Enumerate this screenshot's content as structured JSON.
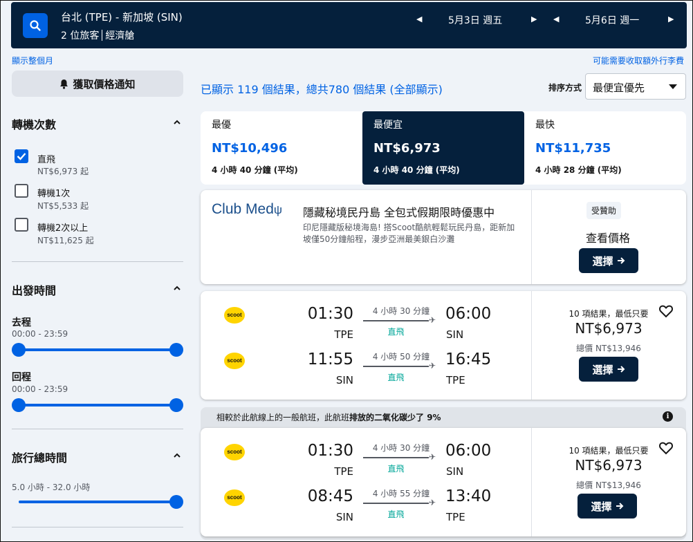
{
  "search": {
    "route": "台北 (TPE) - 新加坡 (SIN)",
    "travellers": "2 位旅客",
    "cabin": "經濟艙",
    "depart_date": "5月3日 週五",
    "return_date": "5月6日 週一"
  },
  "links": {
    "show_month": "顯示整個月",
    "bag_fees": "可能需要收取額外行李費"
  },
  "sidebar": {
    "price_alert": "獲取價格通知",
    "stops_title": "轉機次數",
    "stops": [
      {
        "label": "直飛",
        "price": "NT$6,973 起",
        "checked": true
      },
      {
        "label": "轉機1次",
        "price": "NT$5,533 起",
        "checked": false
      },
      {
        "label": "轉機2次以上",
        "price": "NT$11,625 起",
        "checked": false
      }
    ],
    "departure_title": "出發時間",
    "outbound_label": "去程",
    "outbound_range": "00:00 - 23:59",
    "return_label": "回程",
    "return_range": "00:00 - 23:59",
    "duration_title": "旅行總時間",
    "duration_range": "5.0 小時 - 32.0 小時"
  },
  "results": {
    "count_text": "已顯示 119 個結果，總共780 個結果 (全部顯示)",
    "sort_label": "排序方式",
    "sort_value": "最便宜優先"
  },
  "tabs": [
    {
      "label": "最優",
      "price": "NT$10,496",
      "duration": "4 小時 40 分鐘 (平均)",
      "active": false
    },
    {
      "label": "最便宜",
      "price": "NT$6,973",
      "duration": "4 小時 40 分鐘 (平均)",
      "active": true
    },
    {
      "label": "最快",
      "price": "NT$11,735",
      "duration": "4 小時 28 分鐘 (平均)",
      "active": false
    }
  ],
  "ad": {
    "brand": "Club Med",
    "title": "隱藏秘境民丹島 全包式假期限時優惠中",
    "description": "印尼隱藏版秘境海島! 搭Scoot酷航輕鬆玩民丹島，距新加坡僅50分鐘船程，漫步亞洲最美銀白沙灘",
    "sponsored": "受贊助",
    "view_price": "查看價格",
    "select": "選擇"
  },
  "eco_banner": {
    "text_plain": "相較於此航線上的一般航班，此航班",
    "text_bold": "排放的二氧化碳少了 9%",
    "info": "i"
  },
  "flights": [
    {
      "legs": [
        {
          "airline": "scoot",
          "dep_time": "01:30",
          "dep_airport": "TPE",
          "arr_time": "06:00",
          "arr_airport": "SIN",
          "duration": "4 小時 30 分鐘",
          "stops": "直飛"
        },
        {
          "airline": "scoot",
          "dep_time": "11:55",
          "dep_airport": "SIN",
          "arr_time": "16:45",
          "arr_airport": "TPE",
          "duration": "4 小時 50 分鐘",
          "stops": "直飛"
        }
      ],
      "deals": "10 項結果，最低只要",
      "price": "NT$6,973",
      "total": "總價 NT$13,946",
      "select": "選擇"
    },
    {
      "legs": [
        {
          "airline": "scoot",
          "dep_time": "01:30",
          "dep_airport": "TPE",
          "arr_time": "06:00",
          "arr_airport": "SIN",
          "duration": "4 小時 30 分鐘",
          "stops": "直飛"
        },
        {
          "airline": "scoot",
          "dep_time": "08:45",
          "dep_airport": "SIN",
          "arr_time": "13:40",
          "arr_airport": "TPE",
          "duration": "4 小時 55 分鐘",
          "stops": "直飛"
        }
      ],
      "deals": "10 項結果，最低只要",
      "price": "NT$6,973",
      "total": "總價 NT$13,946",
      "select": "選擇"
    }
  ],
  "colors": {
    "navy": "#05203c",
    "blue": "#0062e3",
    "teal": "#00a698",
    "scoot_yellow": "#ffd400"
  }
}
